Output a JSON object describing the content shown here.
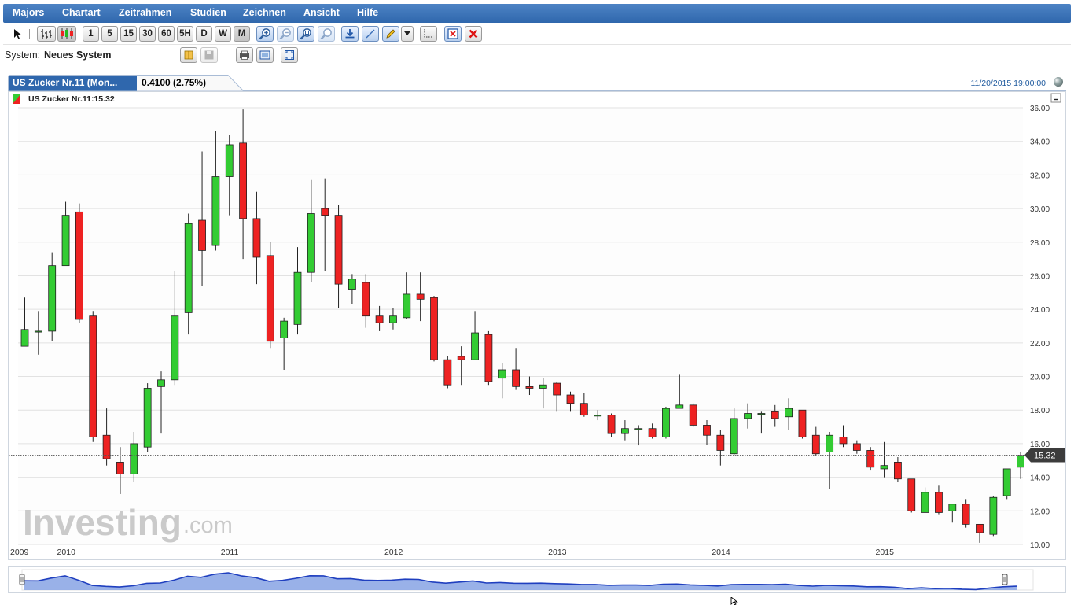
{
  "menu": [
    "Majors",
    "Chartart",
    "Zeitrahmen",
    "Studien",
    "Zeichnen",
    "Ansicht",
    "Hilfe"
  ],
  "toolbar": {
    "periods": [
      "1",
      "5",
      "15",
      "30",
      "60",
      "5H",
      "D",
      "W",
      "M"
    ],
    "selected_period": "M",
    "icons": [
      "pointer-icon",
      "bar-chart-icon",
      "candlestick-icon",
      "zoom-in-icon",
      "zoom-out-icon",
      "zoom-fit-icon",
      "zoom-reset-icon",
      "download-icon",
      "line-tool-icon",
      "pencil-icon",
      "dropdown-icon",
      "crosshair-icon",
      "delete-drawings-icon",
      "close-icon"
    ]
  },
  "system": {
    "label": "System:",
    "value": "Neues System"
  },
  "tab": {
    "title": "US Zucker Nr.11 (Mon...",
    "change": "0.4100 (2.75%)"
  },
  "datetime": "11/20/2015 19:00:00",
  "legend": {
    "label": "US Zucker Nr.11:15.32"
  },
  "watermark": {
    "main": "Investing",
    "suffix": ".com"
  },
  "colors": {
    "up": "#33cc33",
    "down": "#ee2222",
    "grid": "#e2e2e2",
    "accent": "#2f67ad",
    "navigator_line": "#1f3fbf",
    "navigator_fill": "#8ea8e6",
    "last_label_bg": "#3c3c3c"
  },
  "chart_data": {
    "type": "candlestick",
    "title": "US Zucker Nr.11",
    "interval": "monthly",
    "yaxis_side": "right",
    "ylim": [
      10,
      36
    ],
    "y_ticks": [
      "10.00",
      "12.00",
      "14.00",
      "16.00",
      "18.00",
      "20.00",
      "22.00",
      "24.00",
      "26.00",
      "28.00",
      "30.00",
      "32.00",
      "34.00",
      "36.00"
    ],
    "x_labels": [
      "2009",
      "2010",
      "2011",
      "2012",
      "2013",
      "2014",
      "2015"
    ],
    "first_month": "2009-10",
    "last_price": 15.32,
    "last_price_label": "15.32",
    "candles": [
      [
        21.8,
        22.8,
        24.7,
        21.8
      ],
      [
        22.7,
        22.7,
        23.9,
        21.3
      ],
      [
        22.7,
        26.6,
        27.4,
        22.1
      ],
      [
        26.6,
        29.6,
        30.4,
        26.6
      ],
      [
        29.8,
        23.4,
        30.3,
        23.2
      ],
      [
        23.6,
        16.4,
        23.9,
        16.1
      ],
      [
        16.5,
        15.1,
        18.1,
        14.7
      ],
      [
        14.9,
        14.2,
        15.8,
        13.0
      ],
      [
        14.2,
        16.0,
        16.7,
        13.7
      ],
      [
        15.8,
        19.3,
        19.6,
        15.5
      ],
      [
        19.4,
        19.8,
        20.3,
        16.6
      ],
      [
        19.8,
        23.6,
        26.3,
        19.5
      ],
      [
        23.8,
        29.1,
        29.7,
        22.5
      ],
      [
        29.3,
        27.5,
        33.4,
        25.4
      ],
      [
        27.8,
        31.9,
        34.6,
        27.5
      ],
      [
        31.9,
        33.8,
        34.4,
        29.6
      ],
      [
        33.9,
        29.4,
        35.9,
        27.0
      ],
      [
        29.4,
        27.1,
        31.0,
        25.5
      ],
      [
        27.2,
        22.1,
        28.0,
        21.7
      ],
      [
        22.3,
        23.3,
        23.5,
        20.4
      ],
      [
        23.1,
        26.2,
        27.7,
        22.5
      ],
      [
        26.2,
        29.7,
        31.7,
        25.6
      ],
      [
        30.0,
        29.6,
        31.8,
        26.3
      ],
      [
        29.6,
        25.5,
        30.2,
        24.1
      ],
      [
        25.2,
        25.8,
        26.1,
        24.3
      ],
      [
        25.6,
        23.6,
        26.1,
        22.9
      ],
      [
        23.6,
        23.2,
        24.2,
        22.7
      ],
      [
        23.2,
        23.6,
        24.1,
        22.8
      ],
      [
        23.5,
        24.9,
        26.2,
        23.4
      ],
      [
        24.9,
        24.6,
        26.2,
        23.3
      ],
      [
        24.7,
        21.0,
        24.8,
        20.9
      ],
      [
        21.0,
        19.5,
        21.2,
        19.3
      ],
      [
        21.2,
        21.0,
        21.8,
        19.5
      ],
      [
        21.0,
        22.6,
        23.9,
        21.0
      ],
      [
        22.5,
        19.7,
        22.7,
        19.5
      ],
      [
        19.9,
        20.4,
        20.8,
        18.7
      ],
      [
        20.4,
        19.4,
        21.7,
        19.2
      ],
      [
        19.4,
        19.3,
        20.0,
        18.9
      ],
      [
        19.3,
        19.5,
        19.9,
        18.1
      ],
      [
        19.6,
        18.9,
        19.7,
        17.9
      ],
      [
        18.9,
        18.4,
        19.1,
        17.9
      ],
      [
        18.4,
        17.7,
        19.0,
        17.6
      ],
      [
        17.7,
        17.7,
        18.0,
        17.4
      ],
      [
        17.7,
        16.6,
        17.8,
        16.4
      ],
      [
        16.6,
        16.9,
        17.4,
        16.2
      ],
      [
        16.9,
        16.9,
        17.1,
        15.9
      ],
      [
        16.9,
        16.4,
        17.2,
        16.3
      ],
      [
        16.4,
        18.1,
        18.2,
        16.3
      ],
      [
        18.1,
        18.3,
        20.1,
        18.1
      ],
      [
        18.3,
        17.1,
        18.4,
        17.0
      ],
      [
        17.1,
        16.5,
        17.4,
        15.9
      ],
      [
        16.5,
        15.6,
        16.8,
        14.7
      ],
      [
        15.4,
        17.5,
        18.1,
        15.3
      ],
      [
        17.5,
        17.8,
        18.4,
        16.9
      ],
      [
        17.8,
        17.8,
        17.9,
        16.6
      ],
      [
        17.9,
        17.5,
        18.3,
        17.0
      ],
      [
        17.6,
        18.1,
        18.7,
        16.8
      ],
      [
        18.0,
        16.4,
        18.0,
        16.3
      ],
      [
        16.5,
        15.4,
        17.0,
        15.3
      ],
      [
        15.5,
        16.5,
        16.7,
        13.3
      ],
      [
        16.4,
        16.0,
        17.1,
        15.8
      ],
      [
        16.0,
        15.6,
        16.2,
        15.4
      ],
      [
        15.6,
        14.6,
        15.8,
        14.4
      ],
      [
        14.5,
        14.7,
        16.1,
        14.0
      ],
      [
        14.9,
        13.9,
        15.2,
        13.7
      ],
      [
        13.9,
        12.0,
        13.9,
        11.9
      ],
      [
        11.9,
        13.1,
        13.4,
        11.9
      ],
      [
        13.1,
        11.9,
        13.5,
        11.8
      ],
      [
        12.0,
        12.4,
        12.4,
        11.3
      ],
      [
        12.4,
        11.2,
        12.7,
        11.0
      ],
      [
        11.2,
        10.7,
        11.2,
        10.1
      ],
      [
        10.6,
        12.8,
        12.9,
        10.5
      ],
      [
        12.9,
        14.5,
        14.5,
        12.7
      ],
      [
        14.6,
        15.3,
        15.5,
        13.9
      ]
    ]
  }
}
